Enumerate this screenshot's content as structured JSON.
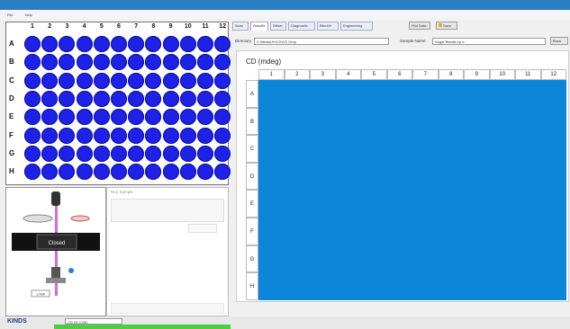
{
  "menu": [
    "File",
    "Help"
  ],
  "plate": {
    "columns": [
      "1",
      "2",
      "3",
      "4",
      "5",
      "6",
      "7",
      "8",
      "9",
      "10",
      "11",
      "12"
    ],
    "rows": [
      "A",
      "B",
      "C",
      "D",
      "E",
      "F",
      "G",
      "H"
    ],
    "well_color": "#1e22e6"
  },
  "instrument": {
    "closed_label": "Closed",
    "value_field": "1.000"
  },
  "run_panel": {
    "title": "Run Sample"
  },
  "tabs": [
    "Scan",
    "Results",
    "Offset",
    "Diagnostic",
    "BikeUV",
    "Engineering"
  ],
  "buttons": {
    "plate_btn": "Plot Data",
    "save_btn": "Save",
    "browse_btn": "Brow"
  },
  "form": {
    "directory_label": "Directory",
    "directory_value": "C:\\MeasUV\\CD\\CD Drop",
    "sample_label": "Sample Name",
    "sample_value": "Sugar Blanks.cp.d"
  },
  "grid": {
    "title": "CD (mdeg)",
    "columns": [
      "1",
      "2",
      "3",
      "4",
      "5",
      "6",
      "7",
      "8",
      "9",
      "10",
      "11",
      "12"
    ],
    "rows": [
      "A",
      "B",
      "C",
      "D",
      "E",
      "F",
      "G",
      "H"
    ],
    "cell_color": "#0c86d8"
  },
  "status": {
    "logo": "KINDS",
    "field": "CD 23 0 000"
  }
}
